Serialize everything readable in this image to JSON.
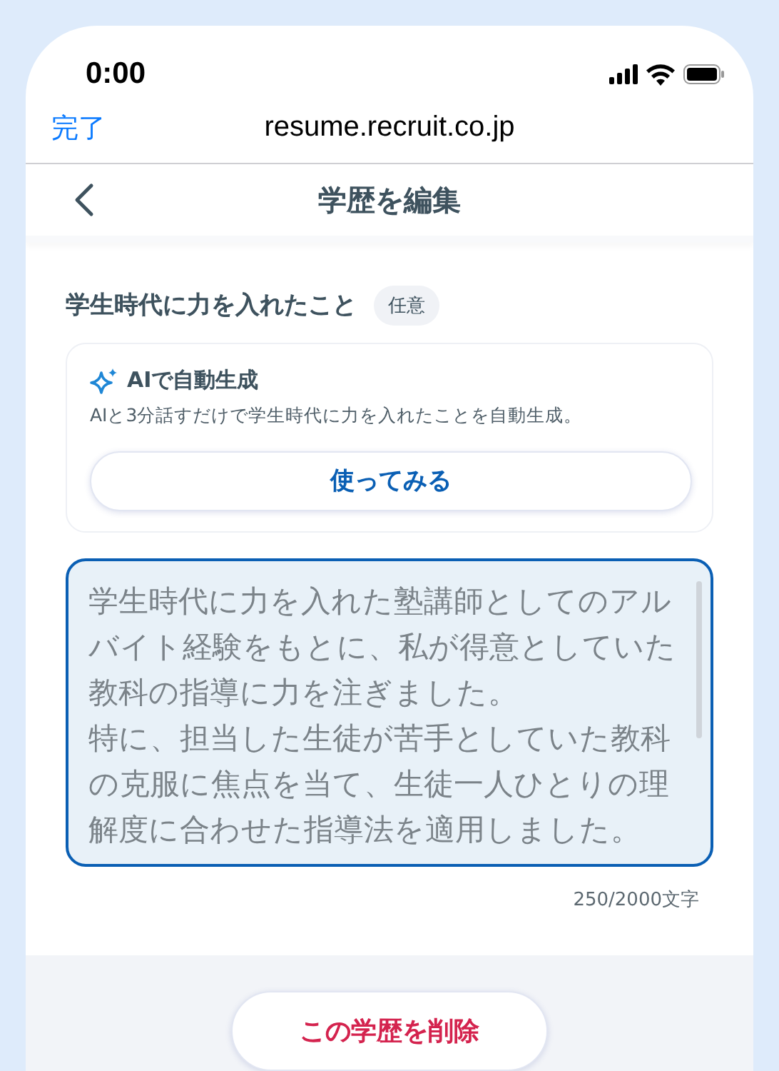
{
  "status_bar": {
    "time": "0:00"
  },
  "browser": {
    "done": "完了",
    "url": "resume.recruit.co.jp"
  },
  "header": {
    "title": "学歴を編集"
  },
  "field": {
    "label": "学生時代に力を入れたこと",
    "badge": "任意",
    "ai_card": {
      "title": "AIで自動生成",
      "description": "AIと3分話すだけで学生時代に力を入れたことを自動生成。",
      "button": "使ってみる"
    },
    "paragraphs": [
      "学生時代に力を入れた塾講師としてのアルバイト経験をもとに、私が得意としていた教科の指導に力を注ぎました。",
      "特に、担当した生徒が苦手としていた教科の克服に焦点を当て、生徒一人ひとりの理解度に合わせた指導法を適用しました。"
    ],
    "focused": true,
    "counter": "250/2000文字"
  },
  "delete_button": "この学歴を削除"
}
